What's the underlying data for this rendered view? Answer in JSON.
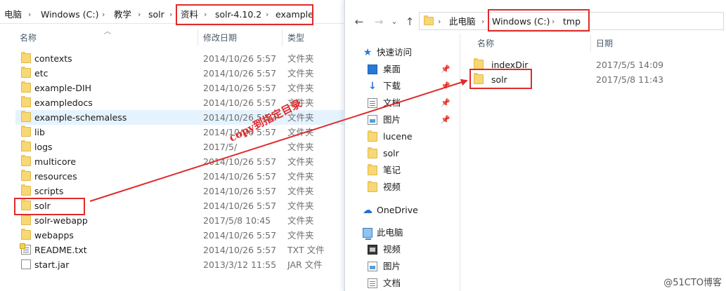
{
  "left_window": {
    "breadcrumbs": [
      "电脑",
      "Windows (C:)",
      "教学",
      "solr",
      "资料",
      "solr-4.10.2",
      "example"
    ],
    "columns": {
      "name": "名称",
      "date": "修改日期",
      "type": "类型"
    },
    "items": [
      {
        "name": "contexts",
        "date": "2014/10/26 5:57",
        "type": "文件夹",
        "icon": "folder-icon"
      },
      {
        "name": "etc",
        "date": "2014/10/26 5:57",
        "type": "文件夹",
        "icon": "folder-icon"
      },
      {
        "name": "example-DIH",
        "date": "2014/10/26 5:57",
        "type": "文件夹",
        "icon": "folder-icon"
      },
      {
        "name": "exampledocs",
        "date": "2014/10/26 5:57",
        "type": "文件夹",
        "icon": "folder-icon"
      },
      {
        "name": "example-schemaless",
        "date": "2014/10/26 5:57",
        "type": "文件夹",
        "icon": "folder-icon"
      },
      {
        "name": "lib",
        "date": "2014/10/26 5:57",
        "type": "文件夹",
        "icon": "folder-icon"
      },
      {
        "name": "logs",
        "date": "2017/5/",
        "type": "文件夹",
        "icon": "folder-icon"
      },
      {
        "name": "multicore",
        "date": "2014/10/26 5:57",
        "type": "文件夹",
        "icon": "folder-icon"
      },
      {
        "name": "resources",
        "date": "2014/10/26 5:57",
        "type": "文件夹",
        "icon": "folder-icon"
      },
      {
        "name": "scripts",
        "date": "2014/10/26 5:57",
        "type": "文件夹",
        "icon": "folder-icon"
      },
      {
        "name": "solr",
        "date": "2014/10/26 5:57",
        "type": "文件夹",
        "icon": "folder-icon"
      },
      {
        "name": "solr-webapp",
        "date": "2017/5/8 10:45",
        "type": "文件夹",
        "icon": "folder-icon"
      },
      {
        "name": "webapps",
        "date": "2014/10/26 5:57",
        "type": "文件夹",
        "icon": "folder-icon"
      },
      {
        "name": "README.txt",
        "date": "2014/10/26 5:57",
        "type": "TXT 文件",
        "icon": "text-file-icon"
      },
      {
        "name": "start.jar",
        "date": "2013/3/12 11:55",
        "type": "JAR 文件",
        "icon": "jar-file-icon"
      }
    ]
  },
  "right_window": {
    "breadcrumbs": [
      "此电脑",
      "Windows (C:)",
      "tmp"
    ],
    "nav": {
      "back": "←",
      "forward": "→",
      "dropdown": "⌄",
      "up": "↑"
    },
    "columns": {
      "name": "名称",
      "date": "日期"
    },
    "tree": [
      {
        "label": "快速访问",
        "icon": "star-icon",
        "pinned": false
      },
      {
        "label": "桌面",
        "icon": "desktop-icon",
        "pinned": true
      },
      {
        "label": "下载",
        "icon": "download-icon",
        "pinned": true
      },
      {
        "label": "文档",
        "icon": "document-icon",
        "pinned": true
      },
      {
        "label": "图片",
        "icon": "picture-icon",
        "pinned": true
      },
      {
        "label": "lucene",
        "icon": "folder-icon",
        "pinned": false
      },
      {
        "label": "solr",
        "icon": "folder-icon",
        "pinned": false
      },
      {
        "label": "笔记",
        "icon": "folder-icon",
        "pinned": false
      },
      {
        "label": "视频",
        "icon": "folder-icon",
        "pinned": false
      },
      {
        "label": "OneDrive",
        "icon": "cloud-icon",
        "pinned": false
      },
      {
        "label": "此电脑",
        "icon": "computer-icon",
        "pinned": false
      },
      {
        "label": "视频",
        "icon": "video-icon",
        "pinned": false
      },
      {
        "label": "图片",
        "icon": "picture-icon",
        "pinned": false
      },
      {
        "label": "文档",
        "icon": "document-icon",
        "pinned": false
      }
    ],
    "items": [
      {
        "name": "indexDir",
        "date": "2017/5/5 14:09",
        "icon": "folder-icon"
      },
      {
        "name": "solr",
        "date": "2017/5/8 11:43",
        "icon": "folder-icon"
      }
    ]
  },
  "annotation": {
    "note": "copy到指定目录",
    "color": "#e02a2a"
  },
  "watermark": "@51CTO博客",
  "colors": {
    "selection": "#e5f3ff",
    "folder": "#f8d775",
    "accent": "#2b79d6"
  }
}
